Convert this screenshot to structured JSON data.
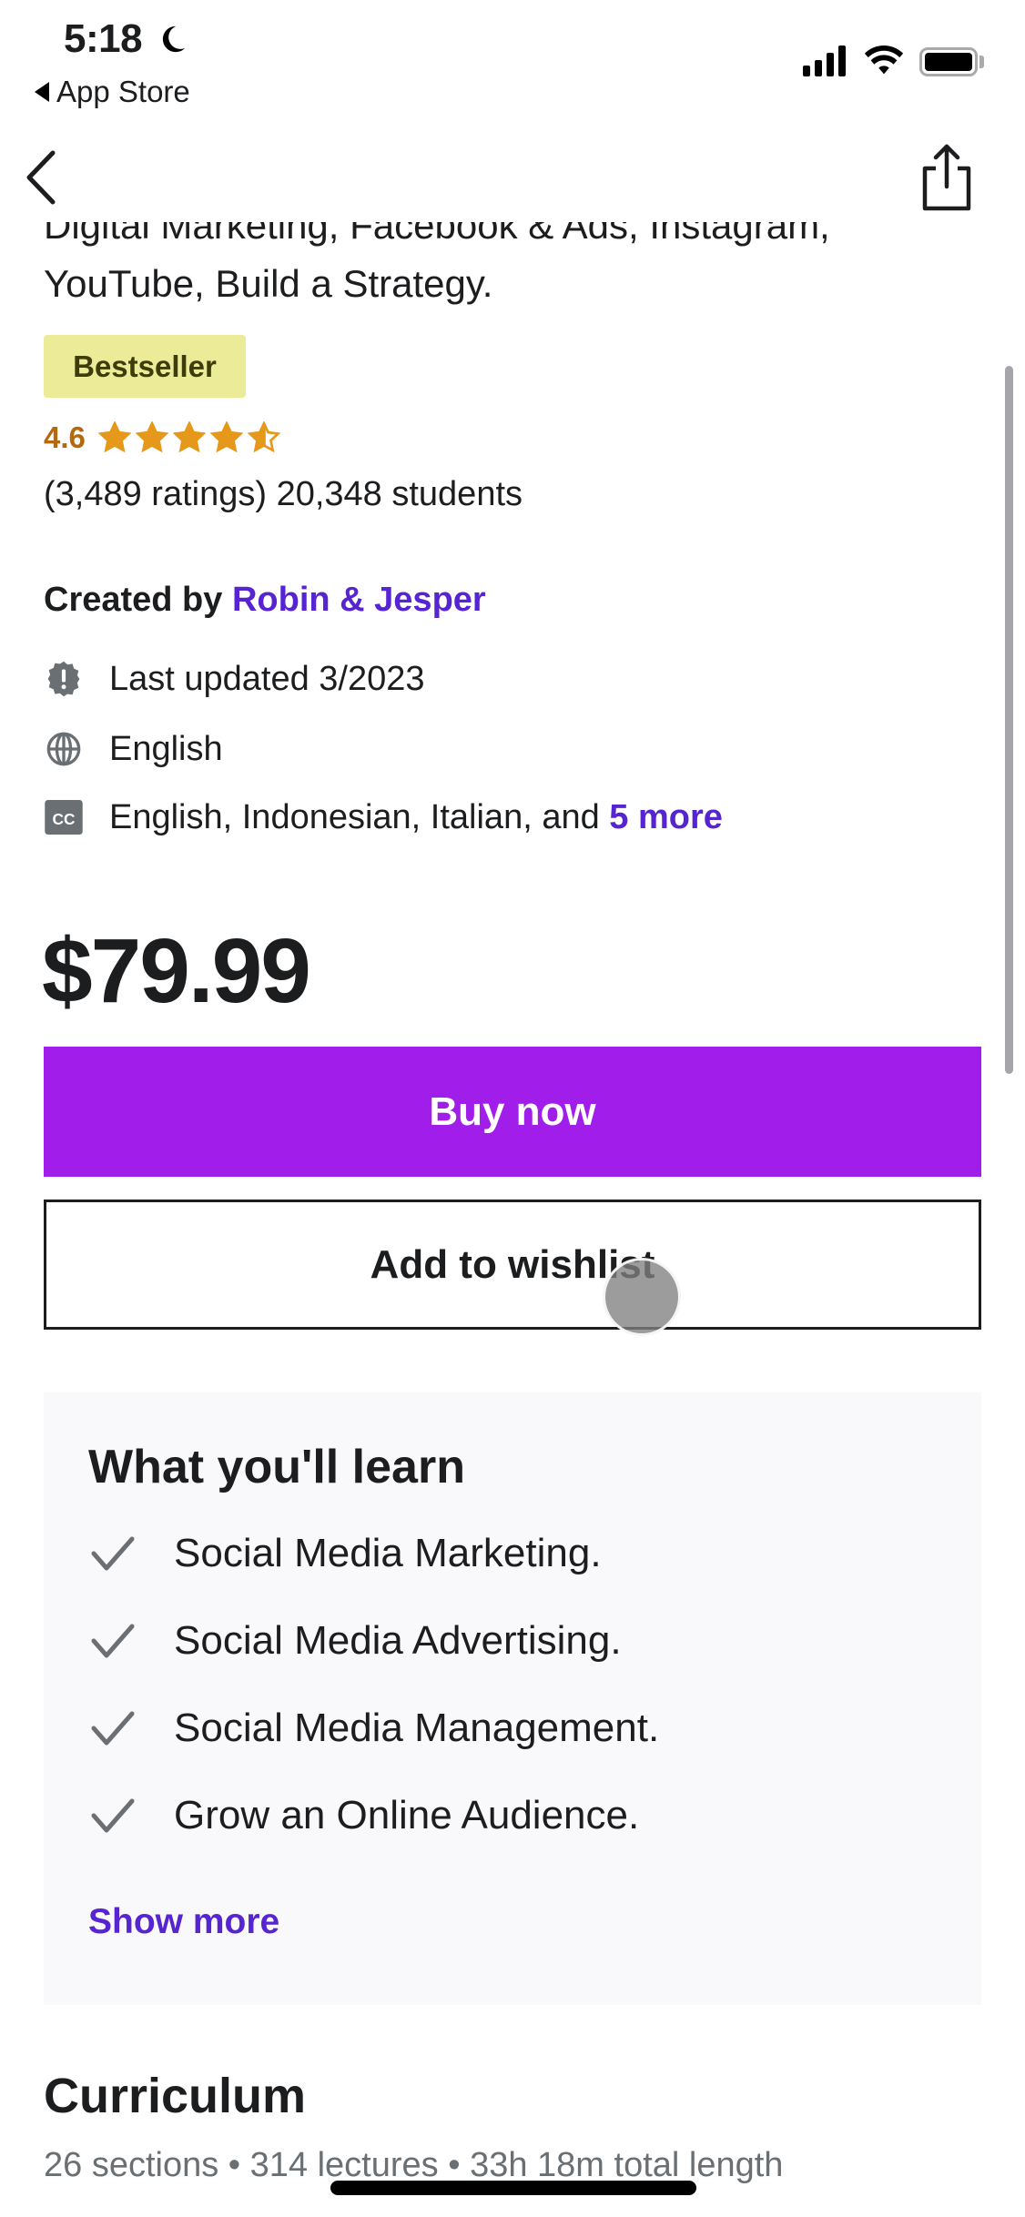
{
  "status_bar": {
    "time": "5:18",
    "focus_icon": "moon-icon",
    "back_to_app": "App Store",
    "icons": [
      "signal-icon",
      "wifi-icon",
      "battery-icon"
    ]
  },
  "nav": {
    "back_icon": "chevron-left-icon",
    "share_icon": "share-icon"
  },
  "course": {
    "title_partial_line": "Digital Marketing, Facebook & Ads, Instagram,",
    "title_last_line": "YouTube, Build a Strategy.",
    "badge": "Bestseller",
    "rating": "4.6",
    "rating_value": 4.6,
    "rating_max": 5,
    "stats": "(3,489 ratings) 20,348 students",
    "created_by_label": "Created by",
    "instructors": "Robin & Jesper",
    "last_updated": "Last updated 3/2023",
    "language": "English",
    "captions_text": "English, Indonesian, Italian, and",
    "captions_more": "5 more",
    "price": "$79.99"
  },
  "actions": {
    "buy_now": "Buy now",
    "add_to_wishlist": "Add to wishlist"
  },
  "learn": {
    "title": "What you'll learn",
    "items": [
      "Social Media Marketing.",
      "Social Media Advertising.",
      "Social Media Management.",
      "Grow an Online Audience."
    ],
    "show_more": "Show more"
  },
  "curriculum": {
    "title": "Curriculum",
    "summary": "26 sections • 314 lectures • 33h 18m total length"
  },
  "colors": {
    "accent_purple": "#a01dea",
    "link_purple": "#5624d0",
    "rating_orange": "#b4690e",
    "star_gold": "#e59819",
    "badge_bg": "#eceb98"
  }
}
